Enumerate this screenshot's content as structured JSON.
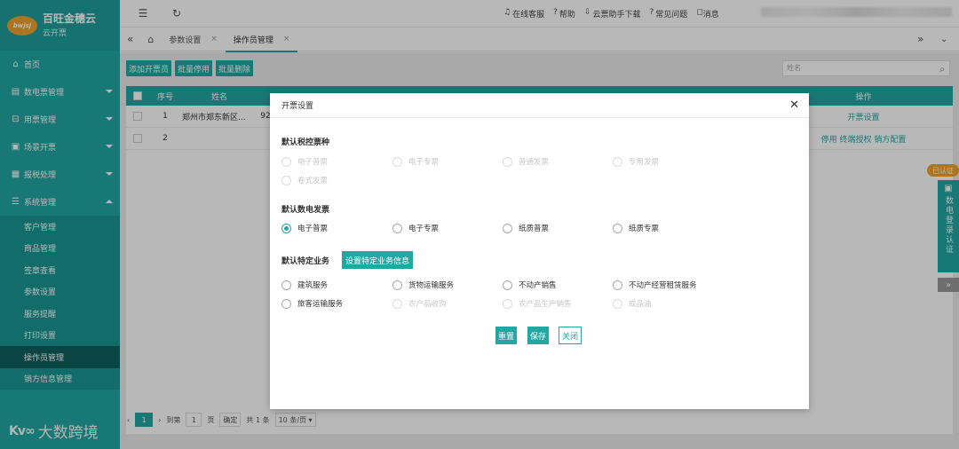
{
  "brand": {
    "logo_text": "bwjsj",
    "name": "百旺金穗云",
    "subtitle": "云开票"
  },
  "sidebar": {
    "items": [
      {
        "label": "首页",
        "icon": "home-icon"
      },
      {
        "label": "数电票管理",
        "icon": "invoice-icon"
      },
      {
        "label": "用票管理",
        "icon": "ticket-icon"
      },
      {
        "label": "场景开票",
        "icon": "scene-icon"
      },
      {
        "label": "报税处理",
        "icon": "tax-icon"
      },
      {
        "label": "系统管理",
        "icon": "settings-icon"
      }
    ],
    "sub_items": [
      {
        "label": "客户管理"
      },
      {
        "label": "商品管理"
      },
      {
        "label": "签章查看"
      },
      {
        "label": "参数设置"
      },
      {
        "label": "服务提醒"
      },
      {
        "label": "打印设置"
      },
      {
        "label": "操作员管理"
      },
      {
        "label": "销方信息管理"
      }
    ]
  },
  "watermark": {
    "logo": "Kv∞",
    "text": "大数跨境"
  },
  "topbar": {
    "links": [
      "在线客服",
      "帮助",
      "云票助手下载",
      "常见问题",
      "消息"
    ]
  },
  "tabs": [
    {
      "label": "参数设置"
    },
    {
      "label": "操作员管理"
    }
  ],
  "toolbar": {
    "add_label": "添加开票员",
    "disable_label": "批量停用",
    "delete_label": "批量删除",
    "search_placeholder": "姓名"
  },
  "table": {
    "headers": {
      "index": "序号",
      "name": "姓名",
      "ops": "操作"
    },
    "rows": [
      {
        "index": "1",
        "name": "郑州市郑东新区...",
        "extra": "92",
        "ops": [
          "开票设置"
        ]
      },
      {
        "index": "2",
        "name": "",
        "extra": "",
        "ops": [
          "停用",
          "终端授权",
          "销方配置"
        ]
      }
    ]
  },
  "float": {
    "badge": "已认证",
    "label": "数电登录认证"
  },
  "pager": {
    "page": "1",
    "goto_prefix": "到第",
    "goto_value": "1",
    "goto_suffix": "页",
    "confirm": "确定",
    "total": "共 1 条",
    "page_size": "10 条/页"
  },
  "modal": {
    "title": "开票设置",
    "sections": {
      "tax_control": "默认税控票种",
      "digital": "默认数电发票",
      "special": "默认特定业务"
    },
    "tax_options": [
      "电子普票",
      "电子专票",
      "普通发票",
      "专用发票",
      "卷式发票"
    ],
    "digital_options": [
      "电子普票",
      "电子专票",
      "纸质普票",
      "纸质专票"
    ],
    "digital_selected": "电子普票",
    "special_button": "设置特定业务信息",
    "special_options_enabled": [
      "建筑服务",
      "货物运输服务",
      "不动产销售",
      "不动产经营租赁服务",
      "旅客运输服务"
    ],
    "special_options_disabled": [
      "农产品收购",
      "农产品生产销售",
      "成品油"
    ],
    "buttons": {
      "reset": "重置",
      "save": "保存",
      "close": "关闭"
    }
  },
  "colors": {
    "accent": "#22a7a3",
    "sidebar_active": "#0f5f5d",
    "badge": "#f0a32b"
  }
}
